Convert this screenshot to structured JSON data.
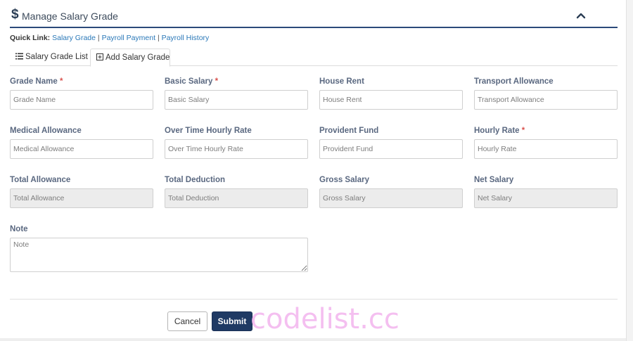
{
  "header": {
    "title": "Manage Salary Grade",
    "icon": "dollar-icon",
    "collapse_icon": "chevron-up-icon"
  },
  "quick_links": {
    "label": "Quick Link:",
    "links": [
      "Salary Grade",
      "Payroll Payment",
      "Payroll History"
    ],
    "separator": "|"
  },
  "tabs": [
    {
      "label": "Salary Grade List",
      "icon": "list-icon",
      "active": false
    },
    {
      "label": "Add Salary Grade",
      "icon": "plus-square-icon",
      "active": true
    }
  ],
  "form": {
    "grade_name": {
      "label": "Grade Name",
      "required_mark": "*",
      "placeholder": "Grade Name"
    },
    "basic_salary": {
      "label": "Basic Salary",
      "required_mark": "*",
      "placeholder": "Basic Salary"
    },
    "house_rent": {
      "label": "House Rent",
      "placeholder": "House Rent"
    },
    "transport_allowance": {
      "label": "Transport Allowance",
      "placeholder": "Transport Allowance"
    },
    "medical_allowance": {
      "label": "Medical Allowance",
      "placeholder": "Medical Allowance"
    },
    "over_time_hourly_rate": {
      "label": "Over Time Hourly Rate",
      "placeholder": "Over Time Hourly Rate"
    },
    "provident_fund": {
      "label": "Provident Fund",
      "placeholder": "Provident Fund"
    },
    "hourly_rate": {
      "label": "Hourly Rate",
      "required_mark": "*",
      "placeholder": "Hourly Rate"
    },
    "total_allowance": {
      "label": "Total Allowance",
      "placeholder": "Total Allowance"
    },
    "total_deduction": {
      "label": "Total Deduction",
      "placeholder": "Total Deduction"
    },
    "gross_salary": {
      "label": "Gross Salary",
      "placeholder": "Gross Salary"
    },
    "net_salary": {
      "label": "Net Salary",
      "placeholder": "Net Salary"
    },
    "note": {
      "label": "Note",
      "placeholder": "Note"
    }
  },
  "buttons": {
    "cancel": "Cancel",
    "submit": "Submit"
  },
  "watermark": "codelist.cc",
  "colors": {
    "accent": "#2b4a7a",
    "link": "#2a78b8",
    "submit_bg": "#1f3a64",
    "required": "#d9534f",
    "readonly_bg": "#ececec"
  }
}
